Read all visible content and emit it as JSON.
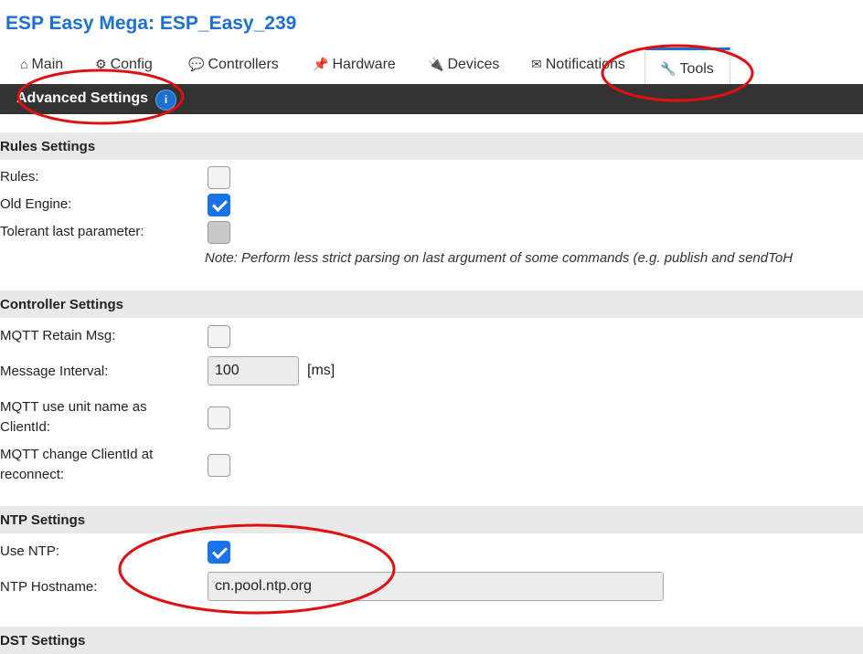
{
  "app": {
    "title": "ESP Easy Mega: ESP_Easy_239"
  },
  "tabs": [
    {
      "icon": "home-icon",
      "glyph": "⌂",
      "label": "Main"
    },
    {
      "icon": "gear-icon",
      "glyph": "⚙",
      "label": "Config"
    },
    {
      "icon": "speech-bubble-icon",
      "glyph": "💬",
      "label": "Controllers"
    },
    {
      "icon": "pushpin-icon",
      "glyph": "📌",
      "label": "Hardware"
    },
    {
      "icon": "plug-icon",
      "glyph": "🔌",
      "label": "Devices"
    },
    {
      "icon": "envelope-icon",
      "glyph": "✉",
      "label": "Notifications"
    },
    {
      "icon": "wrench-icon",
      "glyph": "🔧",
      "label": "Tools",
      "active": true
    }
  ],
  "menubar": {
    "label": "Advanced Settings",
    "info_glyph": "i"
  },
  "sections": {
    "rules": {
      "title": "Rules Settings",
      "rules_label": "Rules:",
      "rules_checked": false,
      "old_engine_label": "Old Engine:",
      "old_engine_checked": true,
      "tolerant_label": "Tolerant last parameter:",
      "tolerant_checked": false,
      "note": "Note: Perform less strict parsing on last argument of some commands (e.g. publish and sendToH"
    },
    "controller": {
      "title": "Controller Settings",
      "retain_label": "MQTT Retain Msg:",
      "retain_checked": false,
      "interval_label": "Message Interval:",
      "interval_value": "100",
      "interval_unit": "[ms]",
      "unitname_label_1": "MQTT use unit name as",
      "unitname_label_2": "ClientId:",
      "unitname_checked": false,
      "change_label_1": "MQTT change ClientId at",
      "change_label_2": "reconnect:",
      "change_checked": false
    },
    "ntp": {
      "title": "NTP Settings",
      "use_label": "Use NTP:",
      "use_checked": true,
      "host_label": "NTP Hostname:",
      "host_value": "cn.pool.ntp.org"
    },
    "dst": {
      "title": "DST Settings"
    }
  },
  "annotations": {
    "ellipse_color": "#e01010"
  }
}
